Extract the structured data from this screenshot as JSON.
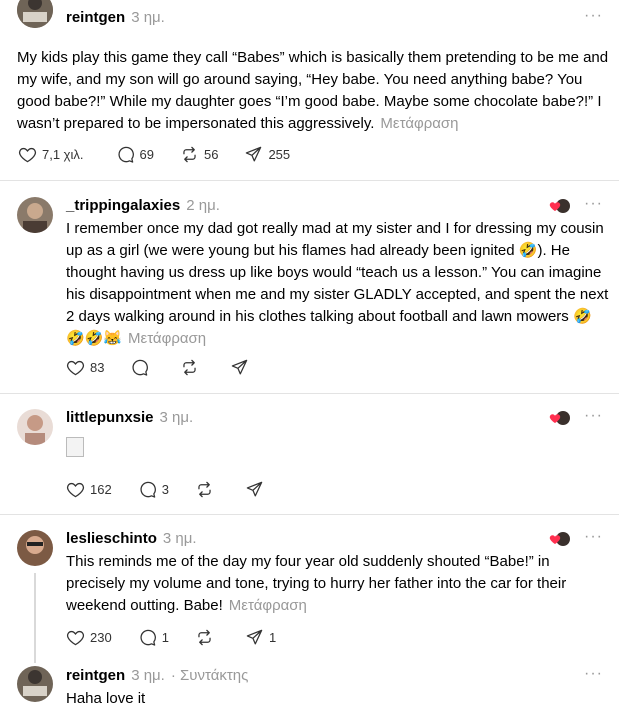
{
  "posts": [
    {
      "user": "reintgen",
      "time": "3 ημ.",
      "text": "My kids play this game they call “Babes” which is basically them pretending to be me and my wife, and my son will go around saying, “Hey babe. You need anything babe? You good babe?!” While my daughter goes “I’m good babe. Maybe some chocolate babe?!” I wasn’t prepared to be impersonated this aggressively.",
      "translate": "Μετάφραση",
      "likes": "7,1 χιλ.",
      "comments": "69",
      "reposts": "56",
      "shares": "255"
    },
    {
      "user": "_trippingalaxies",
      "time": "2 ημ.",
      "text": "I remember once my dad got really mad at my sister and I for dressing my cousin up as a girl (we were young but his flames had already been ignited 🤣). He thought having us dress up like boys would “teach us a lesson.” You can imagine his disappointment when me and my sister GLADLY accepted, and spent the next 2 days walking around in his clothes talking about football and lawn mowers 🤣",
      "emoji_line": "🤣🤣😹",
      "translate": "Μετάφραση",
      "likes": "83"
    },
    {
      "user": "littlepunxsie",
      "time": "3 ημ.",
      "likes": "162",
      "comments": "3"
    },
    {
      "user": "leslieschinto",
      "time": "3 ημ.",
      "text": "This reminds me of the day my four year old suddenly shouted “Babe!” in precisely my volume and tone, trying to hurry her father into the car for their weekend outting. Babe!",
      "translate": "Μετάφραση",
      "likes": "230",
      "comments": "1",
      "shares": "1"
    },
    {
      "user": "reintgen",
      "time": "3 ημ.",
      "author_tag": "· Συντάκτης",
      "text": "Haha love it"
    }
  ],
  "more_glyph": "···"
}
